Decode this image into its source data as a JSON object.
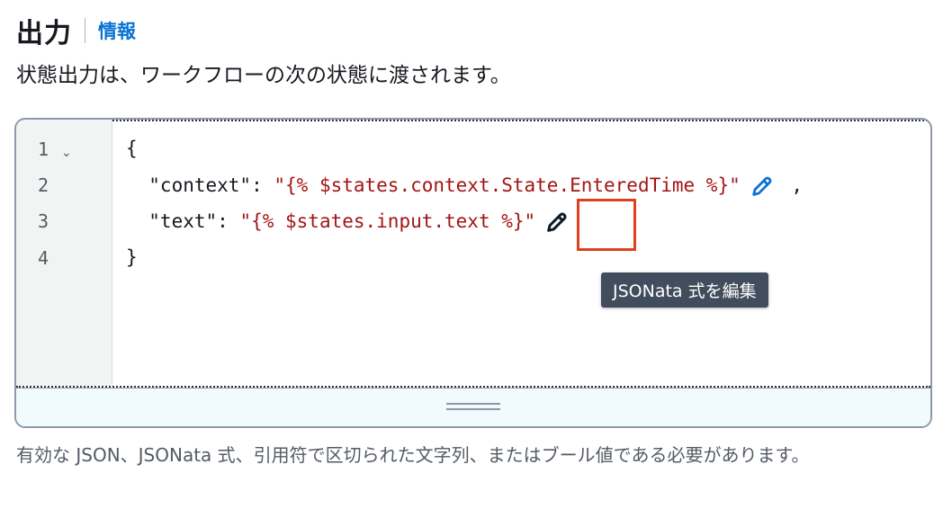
{
  "header": {
    "title": "出力",
    "info_link": "情報",
    "description": "状態出力は、ワークフローの次の状態に渡されます。"
  },
  "editor": {
    "line_numbers": [
      "1",
      "2",
      "3",
      "4"
    ],
    "lines": {
      "l1": "{",
      "l2_key": "  \"context\": ",
      "l2_value": "\"{% $states.context.State.EnteredTime %}\"",
      "l2_suffix": " ,",
      "l3_key": "  \"text\": ",
      "l3_value": "\"{% $states.input.text %}\"",
      "l4": "}"
    },
    "tooltip": "JSONata 式を編集"
  },
  "help_text": "有効な JSON、JSONata 式、引用符で区切られた文字列、またはブール値である必要があります。",
  "colors": {
    "link": "#0972d3",
    "string": "#a31515",
    "highlight": "#e0401e",
    "tooltip_bg": "#414d5c"
  }
}
